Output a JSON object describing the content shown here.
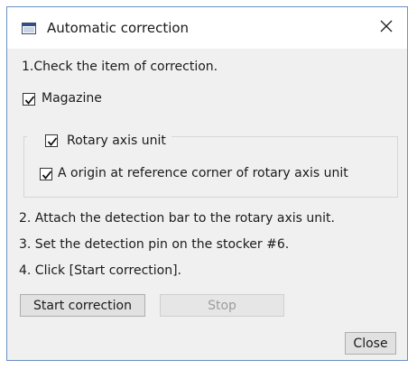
{
  "dialog": {
    "title": "Automatic correction",
    "close_glyph": "✕"
  },
  "instructions": {
    "step1": "1.Check the item of correction.",
    "step2": "2. Attach the detection bar to the rotary axis unit.",
    "step3": "3. Set the detection pin on the stocker #6.",
    "step4": "4. Click [Start correction]."
  },
  "checkboxes": {
    "magazine": {
      "label": "Magazine",
      "checked": true
    },
    "rotary_axis_unit": {
      "label": "Rotary axis unit",
      "checked": true
    },
    "origin_reference_corner": {
      "label": "A origin at reference corner of rotary axis unit",
      "checked": true
    }
  },
  "buttons": {
    "start_correction": "Start correction",
    "stop": "Stop",
    "close": "Close"
  },
  "icons": {
    "app": "window-icon",
    "close": "close-icon",
    "check": "check-icon"
  },
  "colors": {
    "window_border": "#6a8fc4",
    "dialog_background": "#f0f0f0",
    "button_face": "#e1e1e1",
    "disabled_text": "#9d9d9d"
  }
}
